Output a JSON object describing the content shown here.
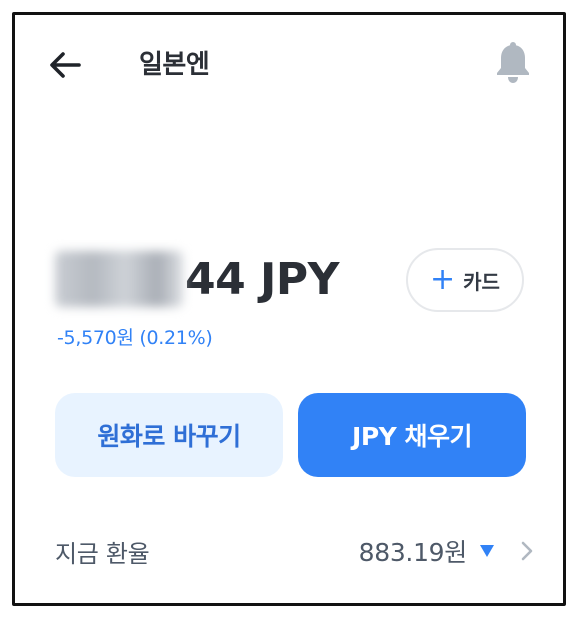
{
  "header": {
    "title": "일본엔"
  },
  "balance": {
    "visible_text": "44 JPY"
  },
  "card_button": {
    "label": "카드"
  },
  "change": {
    "text": "-5,570원 (0.21%)"
  },
  "actions": {
    "exchange_label": "원화로 바꾸기",
    "charge_label": "JPY 채우기"
  },
  "rate": {
    "label": "지금 환율",
    "value": "883.19원",
    "trend": "down"
  },
  "icons": {
    "back": "arrow-left-icon",
    "notification": "bell-icon",
    "add": "plus-icon",
    "trend": "triangle-down-icon",
    "more": "chevron-right-icon"
  },
  "colors": {
    "accent": "#3182f6",
    "accent_light": "#e8f3ff",
    "text_primary": "#2b2f36",
    "text_secondary": "#4e5968",
    "icon_gray": "#b0b8c1"
  }
}
